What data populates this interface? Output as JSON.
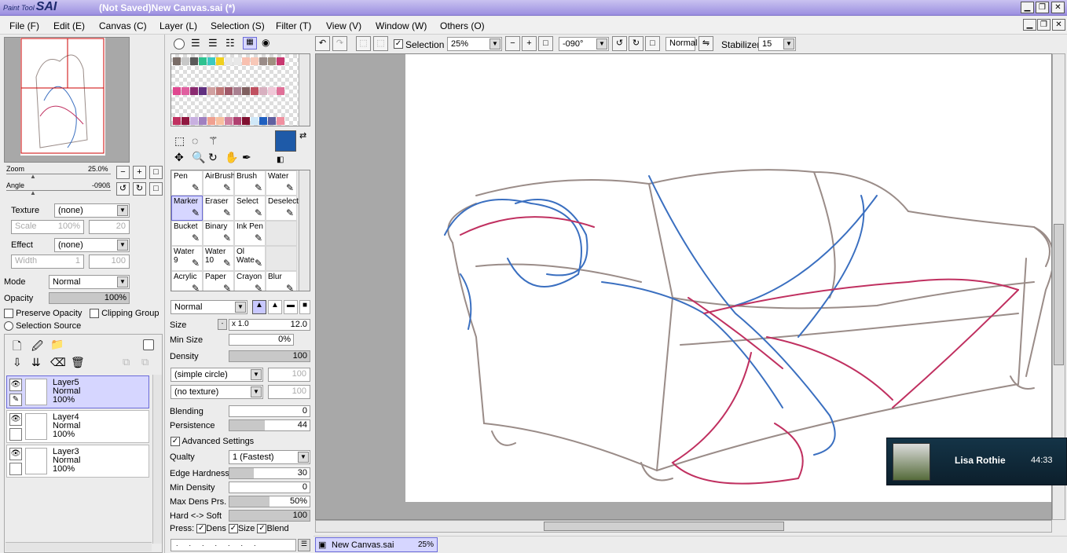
{
  "app": {
    "logo_small": "Paint Tool",
    "logo_big": "SAI",
    "title": "(Not Saved)New Canvas.sai (*)"
  },
  "window_buttons": {
    "minimize": "▁",
    "restore": "❐",
    "close": "✕"
  },
  "menus": [
    "File (F)",
    "Edit (E)",
    "Canvas (C)",
    "Layer (L)",
    "Selection (S)",
    "Filter (T)",
    "View (V)",
    "Window (W)",
    "Others (O)"
  ],
  "navigator": {
    "zoom_label": "Zoom",
    "zoom_value": "25.0%",
    "angle_label": "Angle",
    "angle_value": "-090ß"
  },
  "texture": {
    "label": "Texture",
    "value": "(none)",
    "scale_label": "Scale",
    "scale_value": "100%",
    "scale_num": "20"
  },
  "effect": {
    "label": "Effect",
    "value": "(none)",
    "width_label": "Width",
    "width_value": "1",
    "width_num": "100"
  },
  "layer_props": {
    "mode_label": "Mode",
    "mode_value": "Normal",
    "opacity_label": "Opacity",
    "opacity_value": "100%",
    "opacity_fraction": 1.0,
    "preserve_opacity": "Preserve Opacity",
    "clipping_group": "Clipping Group",
    "selection_source": "Selection Source"
  },
  "layers": [
    {
      "name": "Layer5",
      "mode": "Normal",
      "opacity": "100%",
      "selected": true
    },
    {
      "name": "Layer4",
      "mode": "Normal",
      "opacity": "100%",
      "selected": false
    },
    {
      "name": "Layer3",
      "mode": "Normal",
      "opacity": "100%",
      "selected": false
    }
  ],
  "colors": {
    "primary": "#1e5aa8",
    "secondary": "#000000",
    "accent": "#d6d6ff"
  },
  "swatches": [
    "#7a6d68",
    "#c8c8c8",
    "#5a5a5a",
    "#2ec28f",
    "#3cc9c2",
    "#f0d020",
    "#e8e8e8",
    "#e8e8e8",
    "#f8c0b0",
    "#f8c8b8",
    "#9a8c88",
    "#a09080",
    "#c83870",
    "#e04890",
    "#e060a0",
    "#8a2a70",
    "#603080",
    "#d0a0a0",
    "#c07878",
    "#a05a6a",
    "#a88090",
    "#806060",
    "#c05060",
    "#d8b0c0",
    "#f0c8d8",
    "#e07098",
    "#c03060",
    "#901840",
    "#c8b0e0",
    "#a080c0",
    "#f0a090",
    "#f8c0a0",
    "#d080a0",
    "#b04070",
    "#801030",
    "#d0e8f8",
    "#2060c0",
    "#6060a0",
    "#f090a0"
  ],
  "tools_row": [
    "Pen",
    "AirBrush",
    "Brush",
    "Water",
    "Marker",
    "Eraser",
    "Select",
    "Deselect",
    "Bucket",
    "Binary",
    "Ink Pen",
    "",
    "Water 9",
    "Water 10",
    "Ol Wate",
    "",
    "Acrylic",
    "Paper",
    "Crayon",
    "Blur"
  ],
  "brush": {
    "blend_mode": "Normal",
    "size_label": "Size",
    "size_mult": "x 1.0",
    "size_value": "12.0",
    "min_size_label": "Min Size",
    "min_size_value": "0%",
    "density_label": "Density",
    "density_value": "100",
    "shape": "(simple circle)",
    "shape_num": "100",
    "texture": "(no texture)",
    "texture_num": "100",
    "blending_label": "Blending",
    "blending_value": "0",
    "persistence_label": "Persistence",
    "persistence_value": "44",
    "advanced": "Advanced Settings",
    "quality_label": "Qualty",
    "quality_value": "1 (Fastest)",
    "edge_label": "Edge Hardness",
    "edge_value": "30",
    "mindens_label": "Min Density",
    "mindens_value": "0",
    "maxdens_label": "Max Dens Prs.",
    "maxdens_value": "50%",
    "hardsoft_label": "Hard <-> Soft",
    "hardsoft_value": "100",
    "press_label": "Press:",
    "press_dens": "Dens",
    "press_size": "Size",
    "press_blend": "Blend"
  },
  "toolbar": {
    "selection": "Selection",
    "zoom": "25%",
    "angle": "-090°",
    "mode": "Normal",
    "stabilizer_label": "Stabilizer",
    "stabilizer": "15"
  },
  "statusbar": {
    "file": "New Canvas.sai",
    "zoom": "25%"
  },
  "notification": {
    "name": "Lisa Rothie",
    "time": "44:33"
  }
}
